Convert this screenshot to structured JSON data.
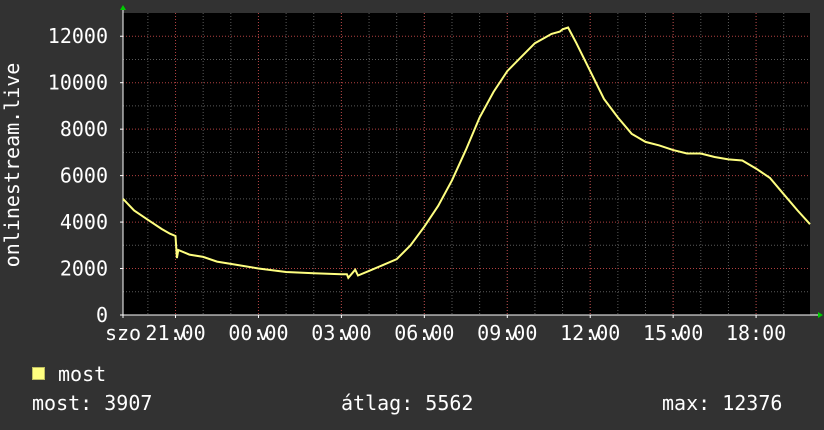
{
  "chart_data": {
    "type": "line",
    "ylabel": "onlinestream.live",
    "ylim": [
      0,
      13000
    ],
    "yticks": [
      0,
      2000,
      4000,
      6000,
      8000,
      10000,
      12000
    ],
    "xlim_hours": [
      19.1,
      19.1
    ],
    "xticks": [
      {
        "label": "szo",
        "hour": 19.1
      },
      {
        "label": "21:00",
        "hour": 21
      },
      {
        "label": "00:00",
        "hour": 24
      },
      {
        "label": "03:00",
        "hour": 27
      },
      {
        "label": "06:00",
        "hour": 30
      },
      {
        "label": "09:00",
        "hour": 33
      },
      {
        "label": "12:00",
        "hour": 36
      },
      {
        "label": "15:00",
        "hour": 39
      },
      {
        "label": "18:00",
        "hour": 42
      }
    ],
    "day_marker_label": "v",
    "day_markers_hours": [
      21.1,
      24.1,
      27.1,
      30.1,
      33.1,
      36.1,
      39.1
    ],
    "series": [
      {
        "name": "most",
        "color": "#ffff80",
        "x_hours": [
          19.1,
          19.5,
          20.0,
          20.5,
          20.8,
          21.0,
          21.05,
          21.1,
          21.5,
          22.0,
          22.5,
          23.0,
          24.0,
          25.0,
          26.0,
          27.0,
          27.1,
          27.2,
          27.25,
          27.5,
          27.6,
          28.0,
          28.5,
          29.0,
          29.5,
          30.0,
          30.5,
          31.0,
          31.5,
          32.0,
          32.5,
          33.0,
          33.5,
          34.0,
          34.3,
          34.6,
          34.9,
          35.0,
          35.2,
          35.5,
          36.0,
          36.5,
          37.0,
          37.5,
          38.0,
          38.5,
          39.0,
          39.5,
          40.0,
          40.5,
          41.0,
          41.5,
          42.0,
          42.5,
          43.0,
          43.5,
          43.95
        ],
        "values": [
          5000,
          4500,
          4100,
          3700,
          3500,
          3400,
          2450,
          2800,
          2600,
          2500,
          2300,
          2200,
          2000,
          1850,
          1800,
          1750,
          1750,
          1750,
          1600,
          1950,
          1700,
          1900,
          2150,
          2400,
          3000,
          3800,
          4700,
          5800,
          7100,
          8500,
          9600,
          10500,
          11100,
          11700,
          11900,
          12100,
          12200,
          12300,
          12376,
          11700,
          10500,
          9300,
          8500,
          7800,
          7450,
          7300,
          7100,
          6950,
          6950,
          6800,
          6700,
          6650,
          6300,
          5900,
          5200,
          4500,
          3907
        ]
      }
    ]
  },
  "legend": {
    "label": "most",
    "color": "#ffff80"
  },
  "stats": {
    "current": "most: 3907",
    "average": "átlag: 5562",
    "max": "max: 12376"
  }
}
